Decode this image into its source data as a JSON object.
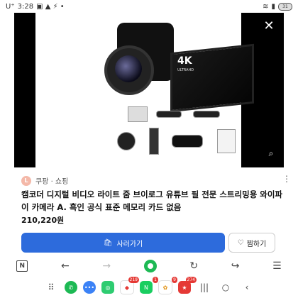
{
  "status_bar": {
    "carrier": "U⁺",
    "time": "3:28",
    "battery": "31"
  },
  "seller": {
    "avatar_letter": "L",
    "name": "쿠팡 · 쇼핑"
  },
  "product": {
    "title": "캠코더 디지털 비디오 라이트 줌 브이로그 유튜브 필 전문 스트리밍용 와이파이 카메라 A. 흑인 공식 표준 메모리 카드 없음",
    "price": "210,220원",
    "screen_badge": "4K",
    "screen_sub": "ULTRAHD"
  },
  "actions": {
    "buy_label": "사러가기",
    "wish_label": "찜하기"
  },
  "browser": {
    "tabs_label": "N"
  },
  "dock": {
    "apps": [
      {
        "name": "apps-grid",
        "badge": ""
      },
      {
        "name": "phone",
        "badge": ""
      },
      {
        "name": "messages",
        "badge": ""
      },
      {
        "name": "chat",
        "badge": ""
      },
      {
        "name": "app-4",
        "badge": "219"
      },
      {
        "name": "naver",
        "badge": "1"
      },
      {
        "name": "app-6",
        "badge": "9"
      },
      {
        "name": "app-7",
        "badge": "274"
      }
    ]
  },
  "colors": {
    "buy_button": "#2d6bdc",
    "home": "#1db954",
    "badge": "#e53935"
  }
}
